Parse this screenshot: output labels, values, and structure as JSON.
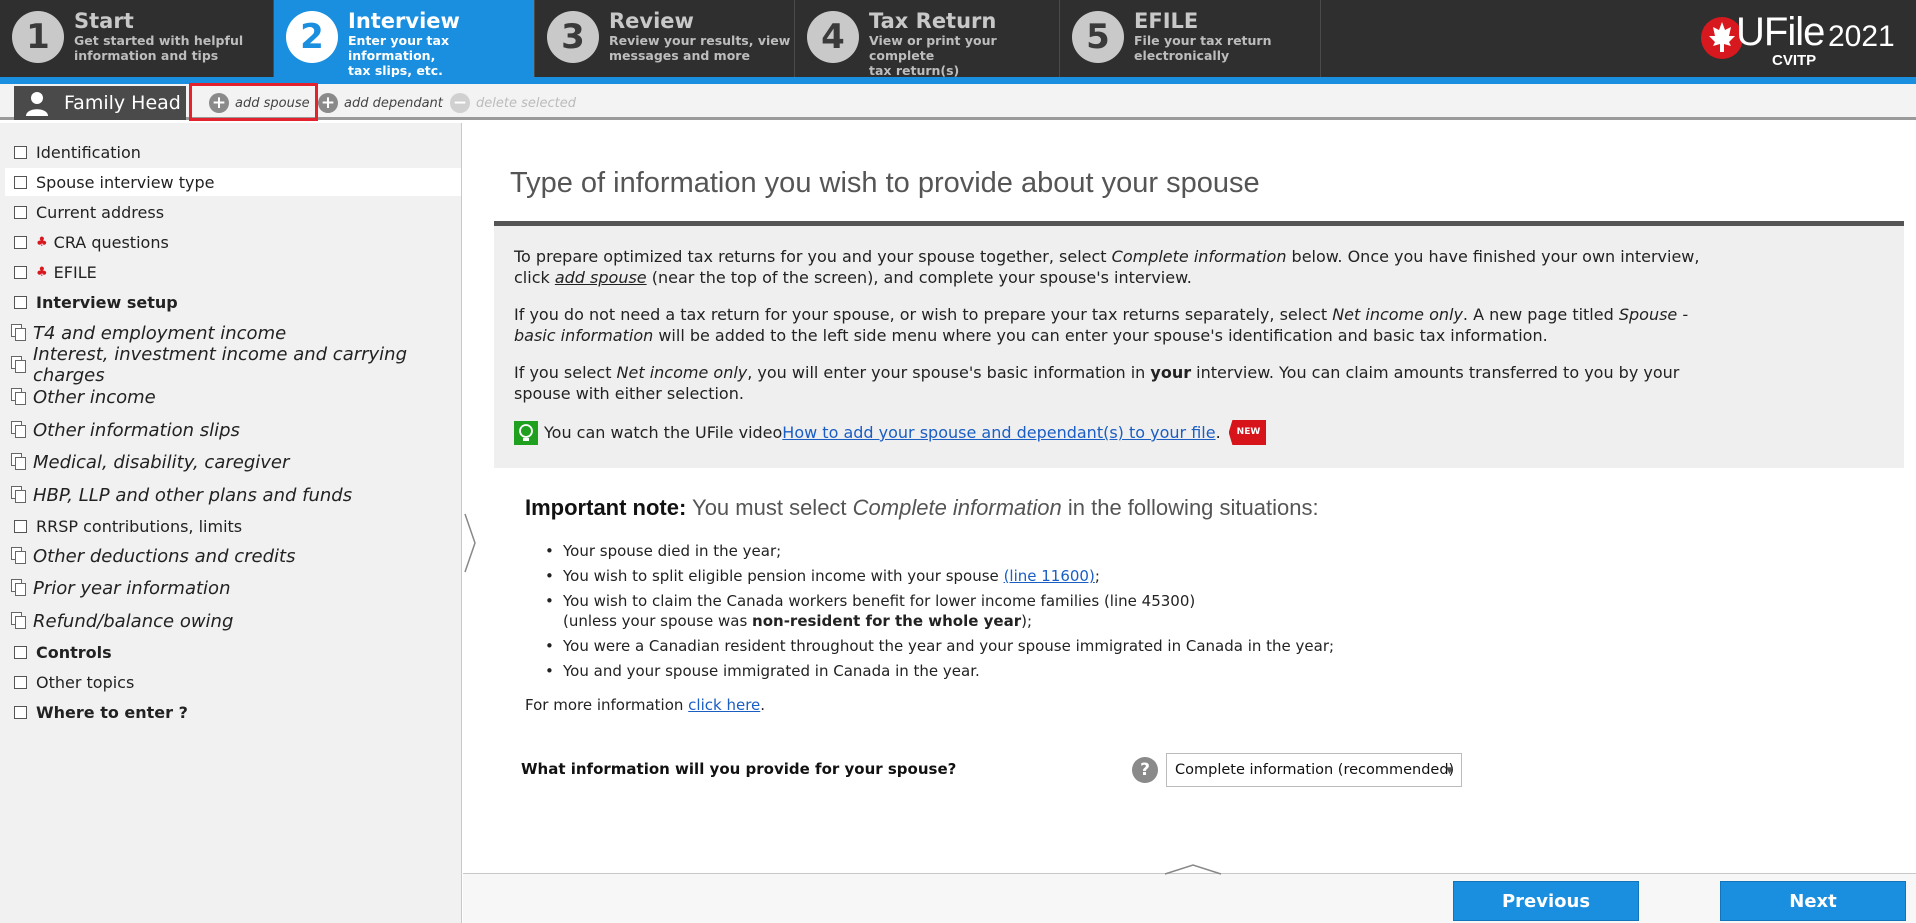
{
  "steps": [
    {
      "num": "1",
      "title": "Start",
      "sub1": "Get started with helpful",
      "sub2": "information and tips"
    },
    {
      "num": "2",
      "title": "Interview",
      "sub1": "Enter your tax information,",
      "sub2": "tax slips, etc."
    },
    {
      "num": "3",
      "title": "Review",
      "sub1": "Review your results, view",
      "sub2": "messages and more"
    },
    {
      "num": "4",
      "title": "Tax Return",
      "sub1": "View or print your complete",
      "sub2": "tax return(s)"
    },
    {
      "num": "5",
      "title": "EFILE",
      "sub1": "File your tax return",
      "sub2": "electronically"
    }
  ],
  "brand": {
    "name": "UFile",
    "year": "2021",
    "edition": "CVITP"
  },
  "memberbar": {
    "family_head": "Family Head",
    "add_spouse": "add spouse",
    "add_dependant": "add dependant",
    "delete_selected": "delete selected"
  },
  "sidebar": {
    "items": [
      {
        "label": "Identification"
      },
      {
        "label": "Spouse interview type"
      },
      {
        "label": "Current address"
      },
      {
        "label": "CRA questions"
      },
      {
        "label": "EFILE"
      },
      {
        "label": "Interview setup"
      },
      {
        "label": "T4 and employment income"
      },
      {
        "label": "Interest, investment income and carrying charges"
      },
      {
        "label": "Other income"
      },
      {
        "label": "Other information slips"
      },
      {
        "label": "Medical, disability, caregiver"
      },
      {
        "label": "HBP, LLP and other plans and funds"
      },
      {
        "label": "RRSP contributions, limits"
      },
      {
        "label": "Other deductions and credits"
      },
      {
        "label": "Prior year information"
      },
      {
        "label": "Refund/balance owing"
      },
      {
        "label": "Controls"
      },
      {
        "label": "Other topics"
      },
      {
        "label": "Where to enter ?"
      }
    ]
  },
  "main": {
    "title": "Type of information you wish to provide about your spouse",
    "p1": {
      "a": "To prepare optimized tax returns for you and your spouse together, select ",
      "b": "Complete information",
      "c": " below. Once you have finished your own interview, click ",
      "d": "add spouse",
      "e": " (near the top of the screen), and complete your spouse's interview."
    },
    "p2": {
      "a": "If you do not need a tax return for your spouse, or wish to prepare your tax returns separately, select ",
      "b": "Net income only",
      "c": ". A new page titled ",
      "d": "Spouse - basic information",
      "e": " will be added to the left side menu where you can enter your spouse's identification and basic tax information."
    },
    "p3": {
      "a": "If you select ",
      "b": "Net income only",
      "c": ", you will enter your spouse's basic information in ",
      "d": "your",
      "e": " interview. You can claim amounts transferred to you by your spouse with either selection."
    },
    "video": {
      "prefix": "You can watch the UFile video ",
      "link": "How to add your spouse and dependant(s) to your file",
      "suffix": ".",
      "badge": "NEW"
    },
    "note": {
      "head": "Important note:",
      "rest_a": " You must select ",
      "rest_b": "Complete information",
      "rest_c": " in the following situations:",
      "b1": "Your spouse died in the year;",
      "b2_a": "You wish to split eligible pension income with your spouse ",
      "b2_link": "(line 11600)",
      "b2_c": ";",
      "b3_a": "You wish to claim the Canada workers benefit for lower income families (line 45300)",
      "b3_b": "(unless your spouse was ",
      "b3_bold": "non-resident for the whole year",
      "b3_c": ");",
      "b4": "You were a Canadian resident throughout the year and your spouse immigrated in Canada in the year;",
      "b5": "You and your spouse immigrated in Canada in the year."
    },
    "more_info": {
      "prefix": "For more information ",
      "link": "click here",
      "suffix": "."
    },
    "question": "What information will you provide for your spouse?",
    "select_value": "Complete information (recommended)"
  },
  "footer": {
    "previous": "Previous",
    "next": "Next"
  },
  "colors": {
    "accent": "#1a8fe0",
    "dark": "#2f2f2f",
    "highlight": "#e3222d",
    "new_badge": "#d8141b"
  }
}
